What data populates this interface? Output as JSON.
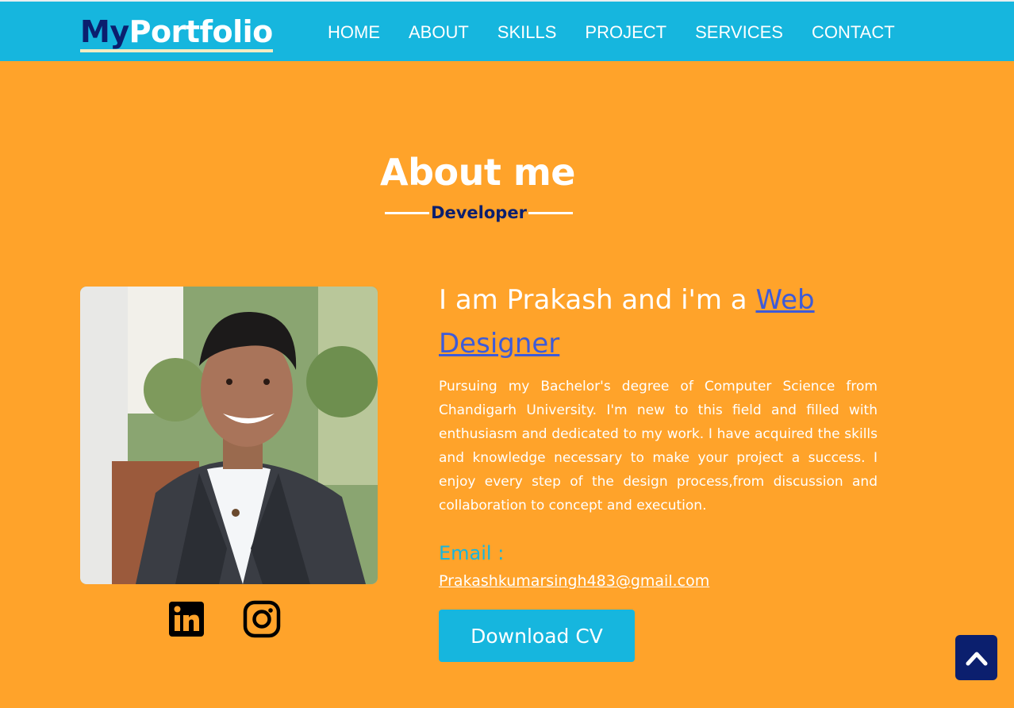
{
  "nav": {
    "logo_part1": "My",
    "logo_part2": "Portfolio",
    "links": [
      "HOME",
      "ABOUT",
      "SKILLS",
      "PROJECT",
      "SERVICES",
      "CONTACT"
    ]
  },
  "about": {
    "title": "About me",
    "subtitle": "Developer",
    "intro_prefix": "I am Prakash and i'm a ",
    "intro_role": "Web Designer",
    "bio": "Pursuing my Bachelor's degree of Computer Science from Chandigarh University. I'm new to this field and filled with enthusiasm and dedicated to my work. I have acquired the skills and knowledge necessary to make your project a success. I enjoy every step of the design process,from discussion and collaboration to concept and execution.",
    "email_label": "Email :",
    "email_value": "Prakashkumarsingh483@gmail.com",
    "download_label": "Download CV"
  },
  "icons": {
    "linkedin": "linkedin-icon",
    "instagram": "instagram-icon",
    "scroll_top": "chevron-up-icon"
  },
  "colors": {
    "background": "#ffa32a",
    "navbar": "#16b6de",
    "navy": "#0b1f6e",
    "link": "#3d5bd9"
  }
}
